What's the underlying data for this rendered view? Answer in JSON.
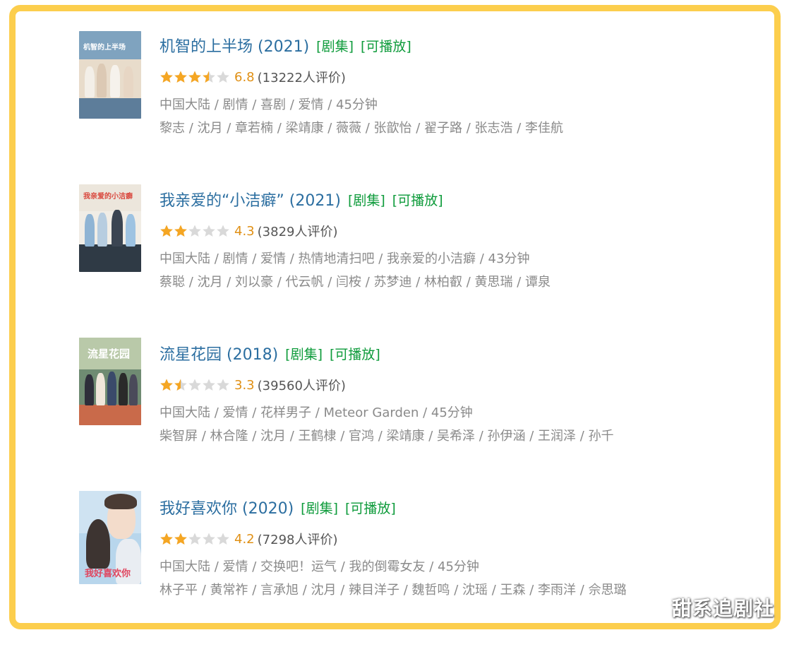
{
  "items": [
    {
      "title": "机智的上半场 (2021)",
      "tag_type": "[剧集]",
      "tag_play": "[可播放]",
      "stars": 3.5,
      "score": "6.8",
      "votes": "(13222人评价)",
      "meta": "中国大陆 / 剧情 / 喜剧 / 爱情 / 45分钟",
      "cast": "黎志 / 沈月 / 章若楠 / 梁靖康 / 薇薇 / 张歆怡 / 翟子路 / 张志浩 / 李佳航",
      "poster_text": "机智的上半场"
    },
    {
      "title": "我亲爱的“小洁癖” (2021)",
      "tag_type": "[剧集]",
      "tag_play": "[可播放]",
      "stars": 2,
      "score": "4.3",
      "votes": "(3829人评价)",
      "meta": "中国大陆 / 剧情 / 爱情 / 热情地清扫吧 / 我亲爱的小洁癖 / 43分钟",
      "cast": "蔡聪 / 沈月 / 刘以豪 / 代云帆 / 闫桉 / 苏梦迪 / 林柏叡 / 黄思瑞 / 谭泉",
      "poster_text": "我亲爱的小洁癖"
    },
    {
      "title": "流星花园 (2018)",
      "tag_type": "[剧集]",
      "tag_play": "[可播放]",
      "stars": 1.5,
      "score": "3.3",
      "votes": "(39560人评价)",
      "meta": "中国大陆 / 爱情 / 花样男子 / Meteor Garden / 45分钟",
      "cast": "柴智屏 / 林合隆 / 沈月 / 王鹤棣 / 官鸿 / 梁靖康 / 吴希泽 / 孙伊涵 / 王润泽 / 孙千",
      "poster_text": "流星花园"
    },
    {
      "title": "我好喜欢你 (2020)",
      "tag_type": "[剧集]",
      "tag_play": "[可播放]",
      "stars": 2,
      "score": "4.2",
      "votes": "(7298人评价)",
      "meta": "中国大陆 / 爱情 / 交换吧！运气 / 我的倒霉女友 / 45分钟",
      "cast": "林子平 / 黄常祚 / 言承旭 / 沈月 / 辣目洋子 / 魏哲鸣 / 沈瑶 / 王森 / 李雨洋 / 佘思璐",
      "poster_text": "我好喜欢你"
    }
  ],
  "watermark": "甜系追剧社",
  "colors": {
    "frame": "#fcce4d",
    "title": "#2b6ea0",
    "tag": "#0e9b3b",
    "star": "#f5a623",
    "star_empty": "#d9d9d9",
    "score": "#e09015",
    "meta": "#8a8a8a"
  }
}
